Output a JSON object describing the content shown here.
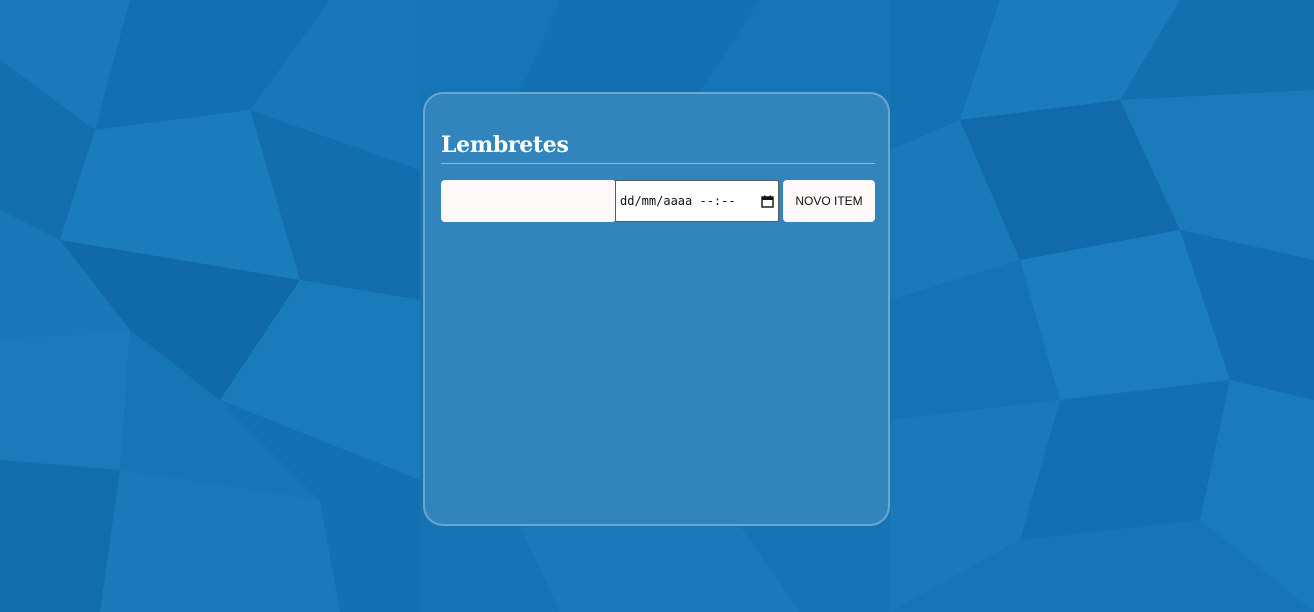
{
  "app": {
    "title": "Lembretes"
  },
  "form": {
    "text_value": "",
    "datetime_display": "dd/mm/aaaa --:--",
    "new_item_label": "NOVO ITEM"
  },
  "colors": {
    "background": "#1674b4",
    "card_border": "#5fa0cf",
    "button_bg": "#fff8f8"
  },
  "icons": {
    "datetime_picker": "calendar-icon"
  }
}
